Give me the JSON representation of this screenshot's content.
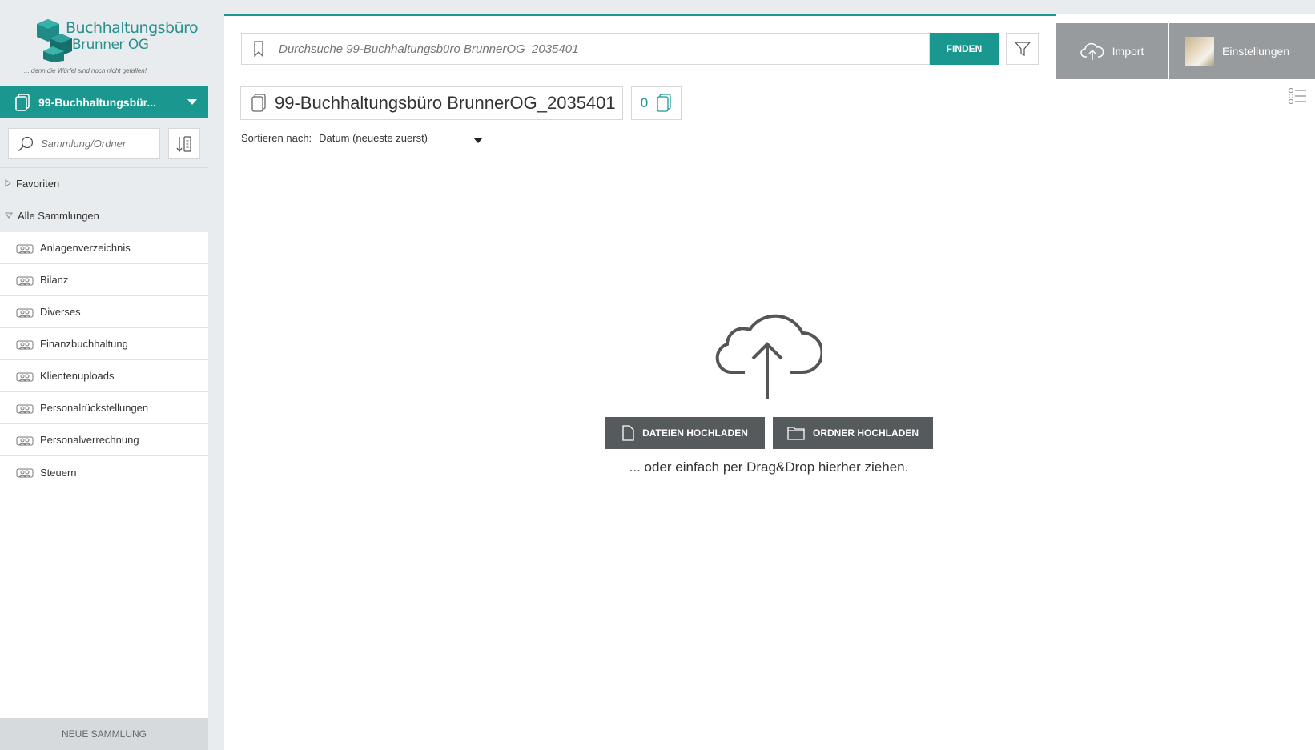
{
  "logo": {
    "line1": "Buchhaltungsbüro",
    "line2": "Brunner OG",
    "tagline": "... denn die Würfel sind noch nicht gefallen!"
  },
  "sidebar": {
    "selected_collection": "99-Buchhaltungsbür...",
    "search_placeholder": "Sammlung/Ordner",
    "tree": {
      "favoriten": "Favoriten",
      "alle_sammlungen": "Alle Sammlungen"
    },
    "collections": [
      {
        "label": "Anlagenverzeichnis"
      },
      {
        "label": "Bilanz"
      },
      {
        "label": "Diverses"
      },
      {
        "label": "Finanzbuchhaltung"
      },
      {
        "label": "Klientenuploads"
      },
      {
        "label": "Personalrückstellungen"
      },
      {
        "label": "Personalverrechnung"
      },
      {
        "label": "Steuern"
      }
    ],
    "new_collection": "NEUE SAMMLUNG"
  },
  "search": {
    "placeholder": "Durchsuche 99-Buchhaltungsbüro BrunnerOG_2035401",
    "button": "FINDEN"
  },
  "header": {
    "import_label": "Import",
    "settings_label": "Einstellungen"
  },
  "collection": {
    "title": "99-Buchhaltungsbüro BrunnerOG_2035401",
    "count": "0"
  },
  "sort": {
    "label": "Sortieren nach:",
    "value": "Datum (neueste zuerst)"
  },
  "upload": {
    "files_button": "DATEIEN HOCHLADEN",
    "folder_button": "ORDNER HOCHLADEN",
    "hint": "... oder einfach per Drag&Drop hierher ziehen."
  },
  "colors": {
    "accent": "#1a978f",
    "header_button": "#979b9e",
    "upload_button": "#555a5d"
  }
}
